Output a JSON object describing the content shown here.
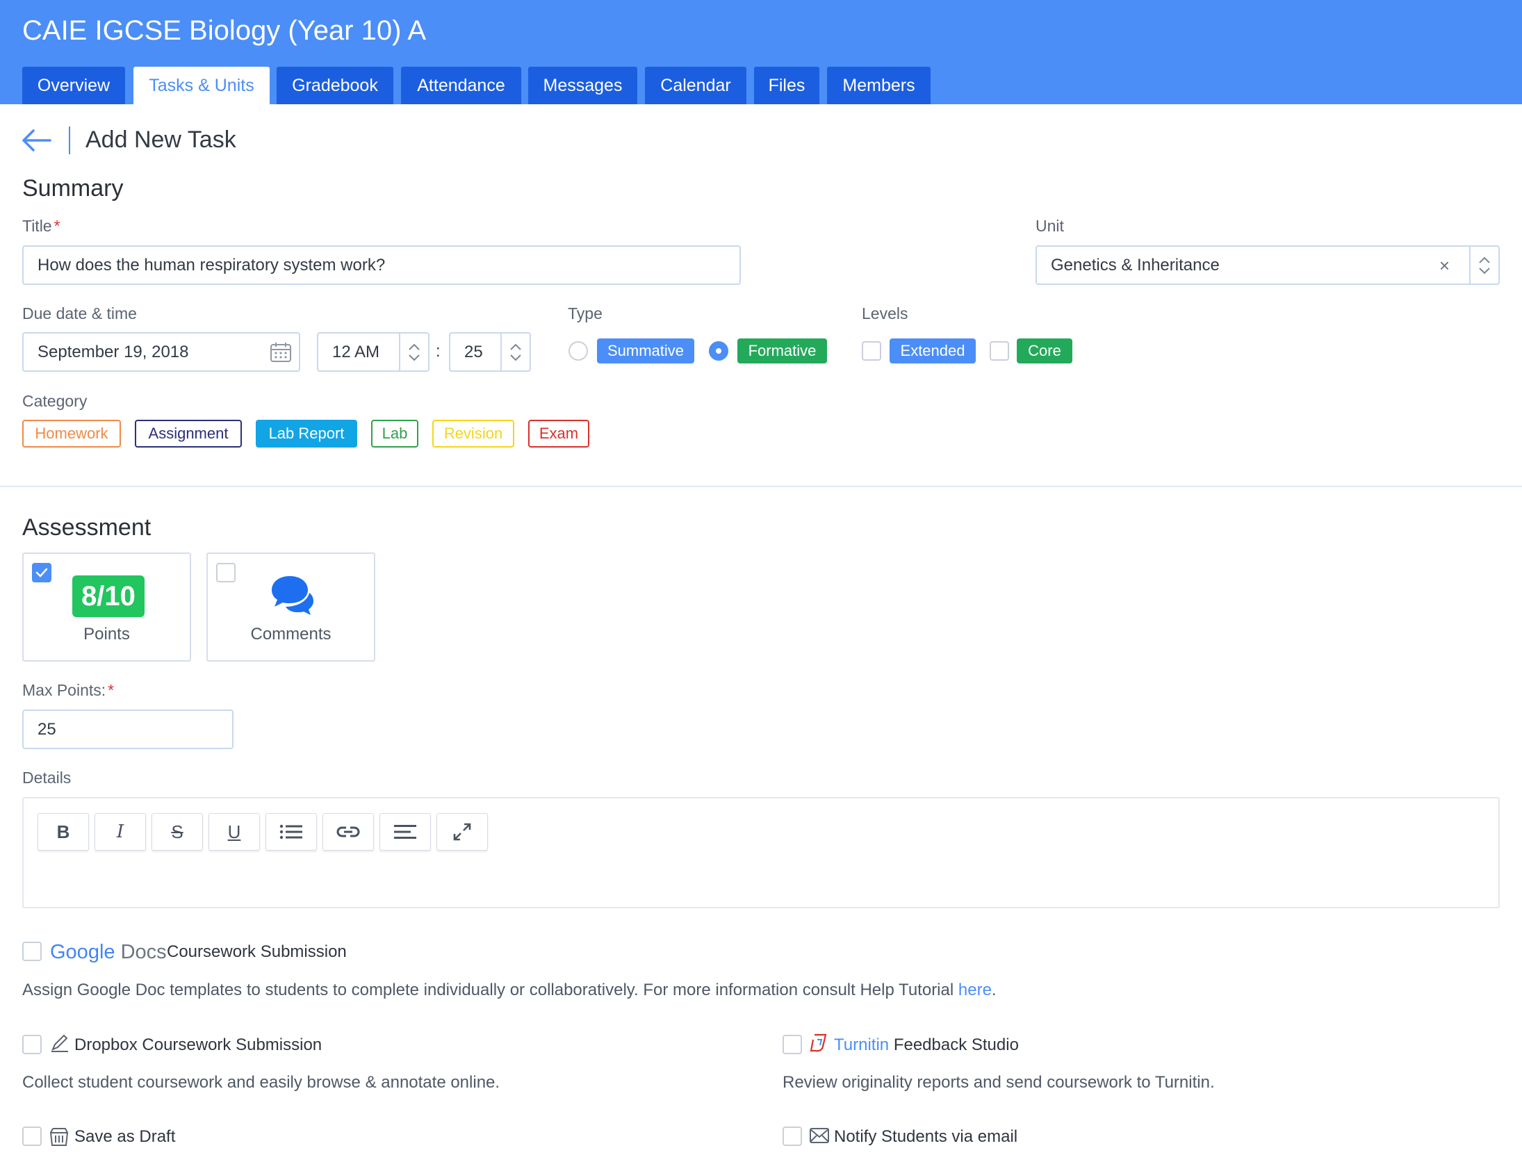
{
  "course": {
    "title": "CAIE IGCSE Biology (Year 10) A"
  },
  "tabs": [
    "Overview",
    "Tasks & Units",
    "Gradebook",
    "Attendance",
    "Messages",
    "Calendar",
    "Files",
    "Members"
  ],
  "page": {
    "title": "Add New Task"
  },
  "summary": {
    "heading": "Summary",
    "title_label": "Title",
    "required_mark": "*",
    "title_value": "How does the human respiratory system work?",
    "unit_label": "Unit",
    "unit_value": "Genetics & Inheritance",
    "unit_clear": "×",
    "due_label": "Due date & time",
    "due_date": "September 19, 2018",
    "due_hour": "12 AM",
    "time_sep": ":",
    "due_minute": "25",
    "type_label": "Type",
    "type_summative": "Summative",
    "type_formative": "Formative",
    "type_selected": "Formative",
    "levels_label": "Levels",
    "level_extended": "Extended",
    "level_core": "Core",
    "category_label": "Category",
    "categories": [
      "Homework",
      "Assignment",
      "Lab Report",
      "Lab",
      "Revision",
      "Exam"
    ],
    "category_selected": "Lab Report"
  },
  "assessment": {
    "heading": "Assessment",
    "points_badge": "8/10",
    "points_label": "Points",
    "points_checked": true,
    "comments_label": "Comments",
    "comments_checked": false,
    "max_points_label": "Max Points:",
    "max_points_value": "25",
    "details_label": "Details",
    "toolbar": [
      "B",
      "I",
      "S",
      "U",
      "bullet-list",
      "link",
      "align",
      "expand"
    ]
  },
  "options": {
    "google_word": "Google",
    "docs_word": "Docs",
    "google_title": "Coursework Submission",
    "google_desc": "Assign Google Doc templates to students to complete individually or collaboratively. For more information consult Help Tutorial",
    "google_link": "here",
    "google_period": ".",
    "dropbox_title": "Dropbox Coursework Submission",
    "dropbox_desc": "Collect student coursework and easily browse & annotate online.",
    "turnitin_word": "Turnitin",
    "turnitin_title": "Feedback Studio",
    "turnitin_desc": "Review originality reports and send coursework to Turnitin.",
    "draft_label": "Save as Draft",
    "notify_label": "Notify Students via email"
  },
  "colors": {
    "brand_blue": "#4b8ef7",
    "tab_blue": "#1b5ee0",
    "formative_green": "#23a95a",
    "homework": "#f08a48",
    "assignment": "#2b2f7a",
    "lab_report": "#12a5e6",
    "lab": "#2ea34a",
    "revision": "#f5d51a",
    "exam": "#d9302b"
  }
}
